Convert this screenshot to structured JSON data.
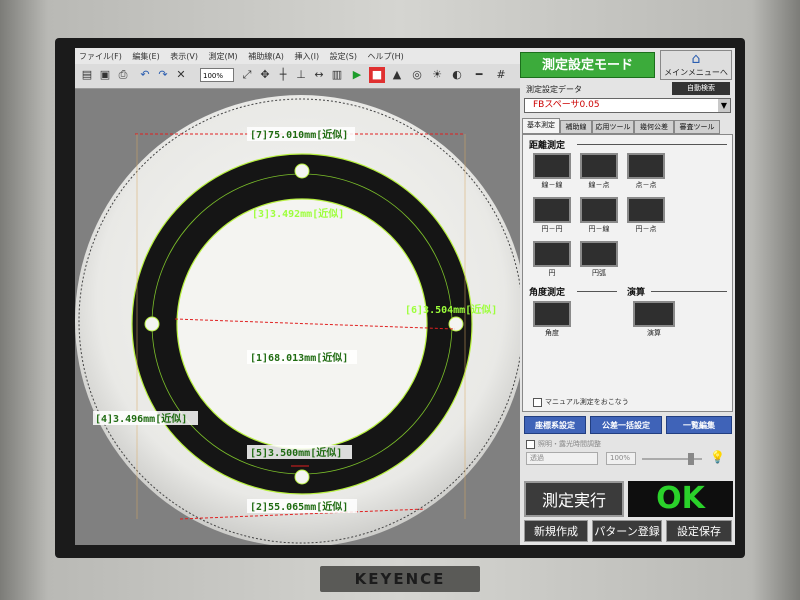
{
  "menu": [
    "ファイル(F)",
    "編集(E)",
    "表示(V)",
    "測定(M)",
    "補助線(A)",
    "挿入(I)",
    "設定(S)",
    "ヘルプ(H)"
  ],
  "toolbar": {
    "zoom": "100%"
  },
  "viewer": {
    "labels": {
      "m7": "[7]75.010mm[近似]",
      "m3": "[3]3.492mm[近似]",
      "m6": "[6]3.504mm[近似]",
      "m1": "[1]68.013mm[近似]",
      "m4": "[4]3.496mm[近似]",
      "m5": "[5]3.500mm[近似]",
      "m2": "[2]55.065mm[近似]"
    }
  },
  "panel": {
    "mode_button": "測定設定モード",
    "main_menu": "メインメニューへ",
    "setting_data_label": "測定設定データ",
    "auto_search": "自動検索",
    "selected_setting": "FBスペーサ0.05",
    "tabs": [
      "基本測定",
      "補助線",
      "応用ツール",
      "幾何公差",
      "審査ツール"
    ],
    "distance_section": "距離測定",
    "distance_items": [
      "線－線",
      "線－点",
      "点－点",
      "円－円",
      "円－線",
      "円－点",
      "円",
      "円弧"
    ],
    "angle_section": "角度測定",
    "calc_section": "演算",
    "angle_item": "角度",
    "calc_item": "演算",
    "manual_check": "マニュアル測定をおこなう",
    "coord_button": "座標系設定",
    "tolerance_button": "公差一括設定",
    "list_button": "一覧編集",
    "lighting_label": "照明・露光時間調整",
    "transmission": "透過",
    "opacity": "100%",
    "run_button": "測定実行",
    "result": "OK",
    "new_button": "新規作成",
    "pattern_button": "パターン登録",
    "save_button": "設定保存"
  },
  "brand": "KEYENCE",
  "colors": {
    "accent_green": "#3cab3b",
    "ok_green": "#2ad12a",
    "blue": "#3f63b8",
    "measure_label": "#9dff3b"
  }
}
